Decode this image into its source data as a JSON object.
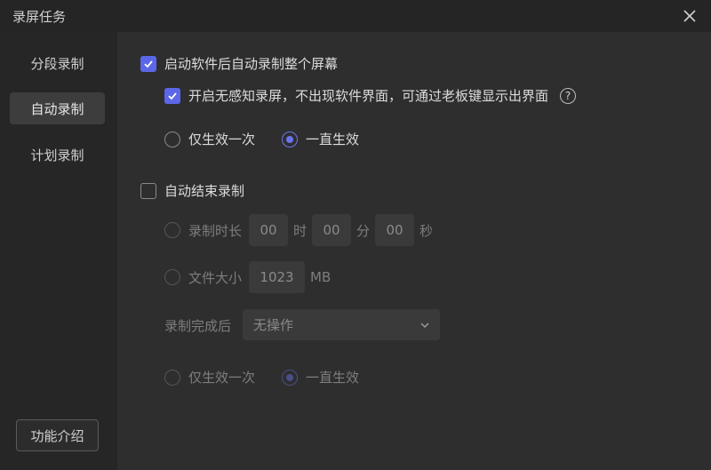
{
  "window": {
    "title": "录屏任务"
  },
  "sidebar": {
    "items": [
      {
        "label": "分段录制",
        "active": false
      },
      {
        "label": "自动录制",
        "active": true
      },
      {
        "label": "计划录制",
        "active": false
      }
    ],
    "intro_button": "功能介绍"
  },
  "main": {
    "auto_start": {
      "label": "启动软件后自动录制整个屏幕",
      "checked": true,
      "silent_option": {
        "label": "开启无感知录屏，不出现软件界面，可通过老板键显示出界面",
        "checked": true
      },
      "scope": {
        "once": "仅生效一次",
        "always": "一直生效",
        "selected": "always"
      }
    },
    "auto_stop": {
      "label": "自动结束录制",
      "checked": false,
      "duration": {
        "label": "录制时长",
        "hours": "00",
        "hours_unit": "时",
        "minutes": "00",
        "minutes_unit": "分",
        "seconds": "00",
        "seconds_unit": "秒"
      },
      "filesize": {
        "label": "文件大小",
        "value": "1023",
        "unit": "MB"
      },
      "after": {
        "label": "录制完成后",
        "value": "无操作"
      },
      "scope": {
        "once": "仅生效一次",
        "always": "一直生效",
        "selected": "always"
      }
    }
  },
  "colors": {
    "accent": "#5c67e8",
    "background": "#2e2e2e",
    "sidebar": "#262626"
  }
}
